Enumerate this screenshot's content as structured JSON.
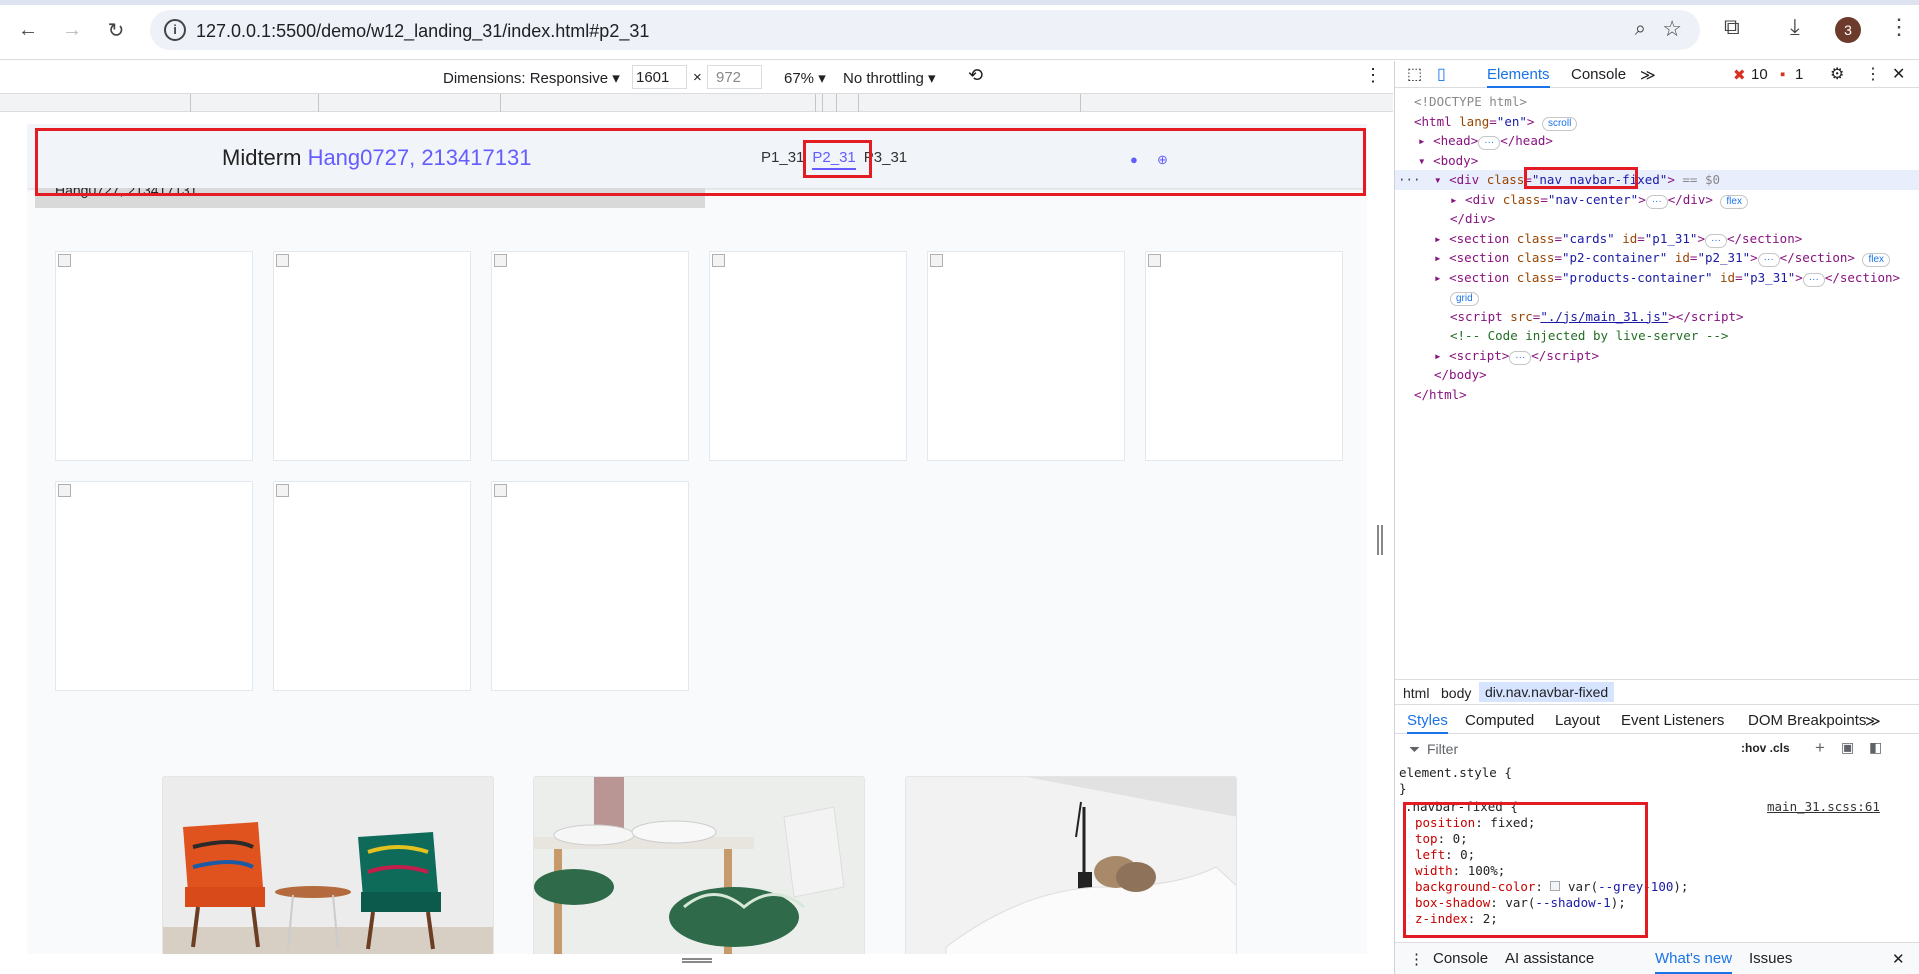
{
  "browser": {
    "url": "127.0.0.1:5500/demo/w12_landing_31/index.html#p2_31",
    "avatar_initial": "3"
  },
  "device_toolbar": {
    "dimensions_label": "Dimensions: Responsive ▾",
    "width": "1601",
    "times": "×",
    "height": "972",
    "zoom": "67% ▾",
    "throttle": "No throttling ▾"
  },
  "page": {
    "brand_prefix": "Midterm ",
    "brand_highlight": "Hang0727, 213417131",
    "nav_links": [
      "P1_31",
      "P2_31",
      "P3_31"
    ],
    "underline_text": "Hang0727, 213417131"
  },
  "devtools": {
    "tabs": {
      "elements": "Elements",
      "console": "Console",
      "more": "≫"
    },
    "errors": "10",
    "warnings": "1",
    "breadcrumbs": [
      "html",
      "body",
      "div.nav.navbar-fixed"
    ],
    "subtabs": [
      "Styles",
      "Computed",
      "Layout",
      "Event Listeners",
      "DOM Breakpoints",
      "≫"
    ],
    "filter_placeholder": "Filter",
    "filter_tools": ":hov .cls",
    "rule_source": "main_31.scss:61",
    "drawer": [
      "Console",
      "AI assistance",
      "What's new",
      "Issues"
    ]
  },
  "colors": {
    "accent": "#645cff",
    "devtools_blue": "#1a73e8",
    "highlight_red": "#e31b23"
  }
}
